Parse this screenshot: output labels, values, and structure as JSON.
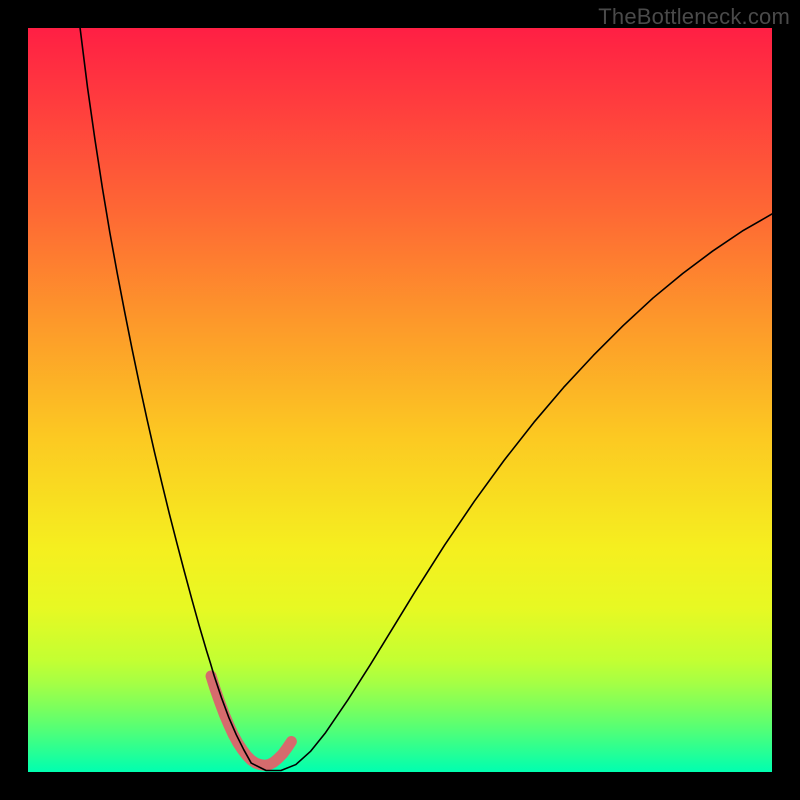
{
  "watermark": "TheBottleneck.com",
  "chart_data": {
    "type": "line",
    "title": "",
    "xlabel": "",
    "ylabel": "",
    "xlim": [
      0,
      100
    ],
    "ylim": [
      0,
      100
    ],
    "grid": false,
    "legend": false,
    "annotations": [],
    "background_gradient": {
      "stops": [
        {
          "offset": 0.0,
          "color": "#ff1f44"
        },
        {
          "offset": 0.1,
          "color": "#ff3c3e"
        },
        {
          "offset": 0.25,
          "color": "#fe6934"
        },
        {
          "offset": 0.4,
          "color": "#fd9a2a"
        },
        {
          "offset": 0.55,
          "color": "#fcc922"
        },
        {
          "offset": 0.7,
          "color": "#f5ef1f"
        },
        {
          "offset": 0.78,
          "color": "#e7f923"
        },
        {
          "offset": 0.85,
          "color": "#c3ff32"
        },
        {
          "offset": 0.88,
          "color": "#a6ff44"
        },
        {
          "offset": 0.91,
          "color": "#80ff5a"
        },
        {
          "offset": 0.94,
          "color": "#57ff74"
        },
        {
          "offset": 0.97,
          "color": "#2bff92"
        },
        {
          "offset": 1.0,
          "color": "#00ffb0"
        }
      ]
    },
    "series": [
      {
        "name": "bottleneck-curve",
        "color": "#000000",
        "stroke_width": 1.6,
        "x": [
          7,
          8,
          9,
          10,
          11,
          12,
          13,
          14,
          15,
          16,
          17,
          18,
          19,
          20,
          21,
          22,
          23,
          24,
          24.5,
          25,
          25.5,
          26,
          27,
          28,
          29,
          30,
          32,
          34,
          36,
          38,
          40,
          43,
          46,
          49,
          52,
          56,
          60,
          64,
          68,
          72,
          76,
          80,
          84,
          88,
          92,
          96,
          100
        ],
        "y": [
          100,
          92,
          85,
          78.5,
          72.5,
          67,
          61.8,
          56.8,
          52,
          47.4,
          43,
          38.8,
          34.7,
          30.8,
          27,
          23.3,
          19.7,
          16.3,
          14.7,
          13,
          11.5,
          10,
          7.3,
          5,
          3,
          1.2,
          0.2,
          0.2,
          1,
          2.8,
          5.3,
          9.7,
          14.4,
          19.3,
          24.2,
          30.5,
          36.4,
          41.9,
          47,
          51.7,
          56,
          60,
          63.7,
          67,
          70,
          72.7,
          75
        ]
      },
      {
        "name": "valley-highlight",
        "color": "#d66b6d",
        "stroke_width": 11,
        "linecap": "round",
        "x": [
          24.6,
          25.2,
          25.8,
          26.4,
          27.0,
          27.6,
          28.2,
          28.8,
          29.4,
          30.0,
          30.6,
          31.2,
          31.8,
          32.4,
          33.0,
          33.6,
          34.2,
          34.8,
          35.4
        ],
        "y": [
          12.9,
          11.0,
          9.3,
          7.7,
          6.3,
          5.0,
          3.9,
          3.0,
          2.2,
          1.6,
          1.2,
          1.0,
          0.9,
          1.0,
          1.3,
          1.8,
          2.4,
          3.2,
          4.1
        ]
      }
    ]
  }
}
